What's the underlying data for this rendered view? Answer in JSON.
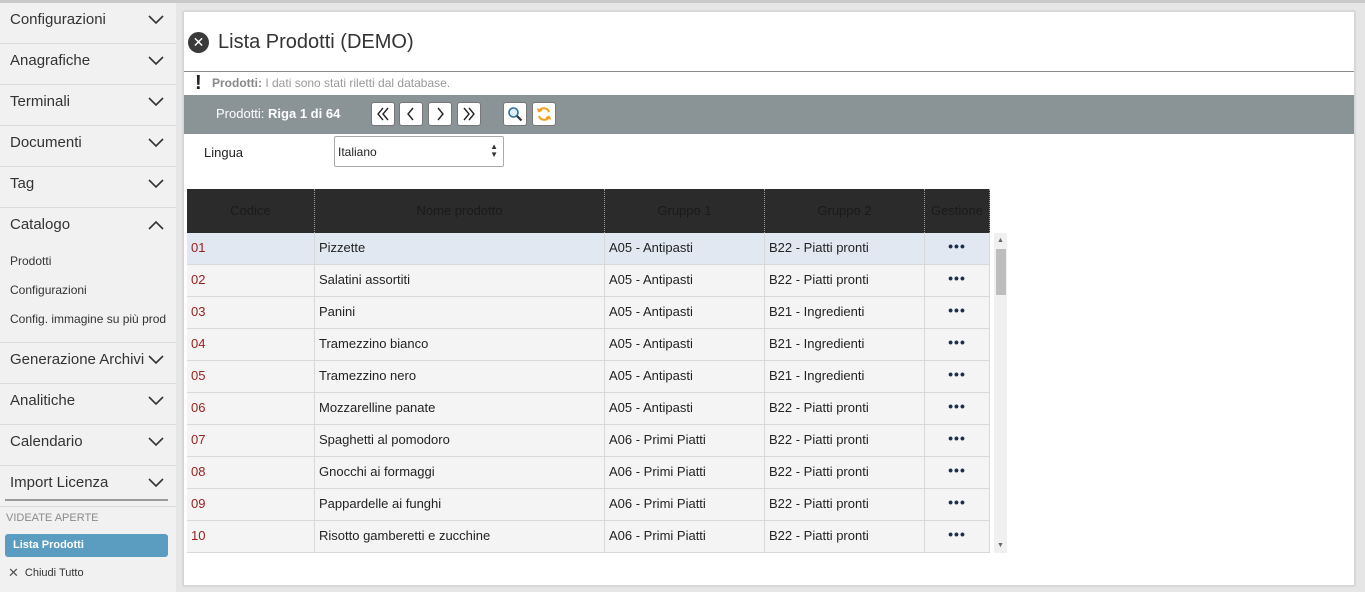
{
  "sidebar": {
    "items": [
      {
        "label": "Configurazioni",
        "expanded": false
      },
      {
        "label": "Anagrafiche",
        "expanded": false
      },
      {
        "label": "Terminali",
        "expanded": false
      },
      {
        "label": "Documenti",
        "expanded": false
      },
      {
        "label": "Tag",
        "expanded": false
      },
      {
        "label": "Catalogo",
        "expanded": true
      },
      {
        "label": "Generazione Archivi",
        "expanded": false
      },
      {
        "label": "Analitiche",
        "expanded": false
      },
      {
        "label": "Calendario",
        "expanded": false
      },
      {
        "label": "Import Licenza",
        "expanded": false
      }
    ],
    "catalogo_sub": [
      "Prodotti",
      "Configurazioni",
      "Config. immagine su più prod"
    ],
    "videate_label": "VIDEATE APERTE",
    "open_tab": "Lista Prodotti",
    "close_all": "Chiudi Tutto"
  },
  "main": {
    "title": "Lista Prodotti (DEMO)",
    "message_bold": "Prodotti:",
    "message_text": "I dati sono stati riletti dal database.",
    "toolbar": {
      "pos_label": "Prodotti:",
      "pos_value": "Riga 1 di 64"
    },
    "lingua_label": "Lingua",
    "lingua_value": "Italiano",
    "table": {
      "headers": [
        "Codice",
        "Nome prodotto",
        "Gruppo 1",
        "Gruppo 2",
        "Gestione"
      ],
      "menu_glyph": "•••",
      "rows": [
        {
          "code": "01",
          "name": "Pizzette",
          "g1": "A05 - Antipasti",
          "g2": "B22 - Piatti pronti"
        },
        {
          "code": "02",
          "name": "Salatini assortiti",
          "g1": "A05 - Antipasti",
          "g2": "B22 - Piatti pronti"
        },
        {
          "code": "03",
          "name": "Panini",
          "g1": "A05 - Antipasti",
          "g2": "B21 - Ingredienti"
        },
        {
          "code": "04",
          "name": "Tramezzino bianco",
          "g1": "A05 - Antipasti",
          "g2": "B21 - Ingredienti"
        },
        {
          "code": "05",
          "name": "Tramezzino nero",
          "g1": "A05 - Antipasti",
          "g2": "B21 - Ingredienti"
        },
        {
          "code": "06",
          "name": "Mozzarelline panate",
          "g1": "A05 - Antipasti",
          "g2": "B22 - Piatti pronti"
        },
        {
          "code": "07",
          "name": "Spaghetti al pomodoro",
          "g1": "A06 - Primi Piatti",
          "g2": "B22 - Piatti pronti"
        },
        {
          "code": "08",
          "name": "Gnocchi ai formaggi",
          "g1": "A06 - Primi Piatti",
          "g2": "B22 - Piatti pronti"
        },
        {
          "code": "09",
          "name": "Pappardelle ai funghi",
          "g1": "A06 - Primi Piatti",
          "g2": "B22 - Piatti pronti"
        },
        {
          "code": "10",
          "name": "Risotto gamberetti e zucchine",
          "g1": "A06 - Primi Piatti",
          "g2": "B22 - Piatti pronti"
        }
      ]
    }
  }
}
